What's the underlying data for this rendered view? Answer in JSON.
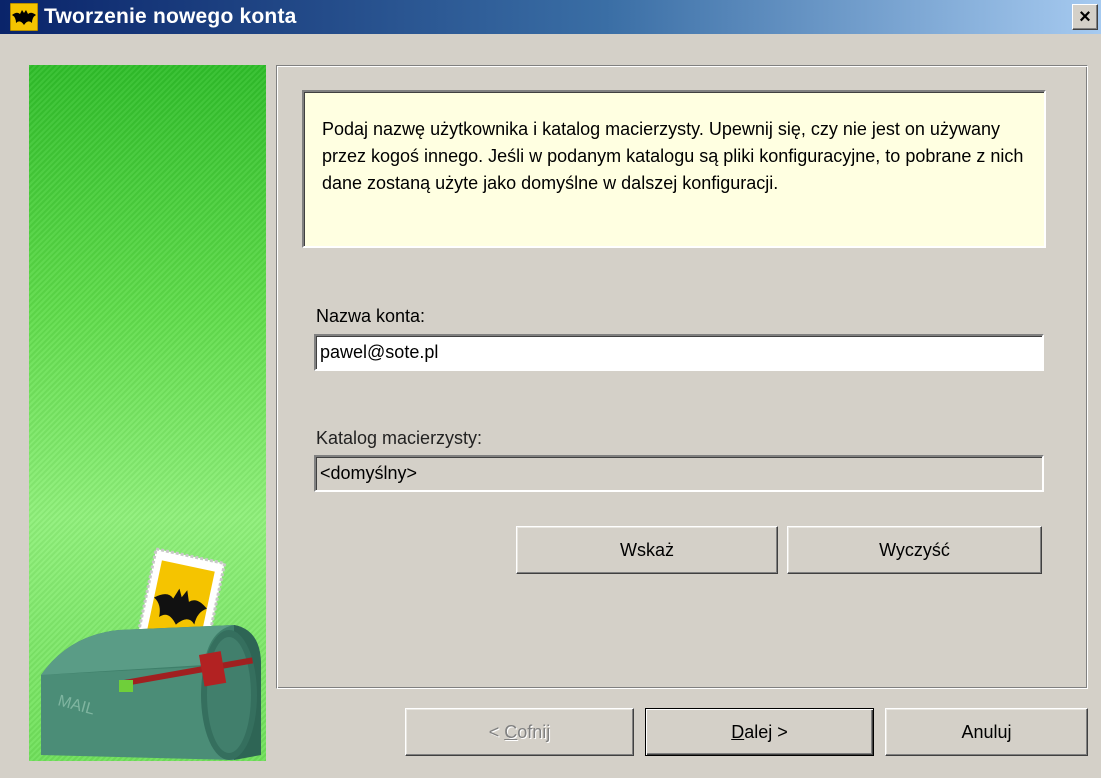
{
  "window": {
    "title": "Tworzenie nowego konta",
    "close_glyph": "×"
  },
  "banner": {
    "mailbox_label": "MAIL",
    "icon": "mailbox-bat-stamp-illustration"
  },
  "info": {
    "text": "Podaj nazwę użytkownika i katalog macierzysty. Upewnij się, czy nie jest on używany przez kogoś innego. Jeśli w podanym katalogu są pliki konfiguracyjne, to pobrane z nich dane zostaną użyte jako domyślne w dalszej konfiguracji."
  },
  "account": {
    "label": "Nazwa konta:",
    "value": "pawel@sote.pl"
  },
  "home_dir": {
    "label": "Katalog macierzysty:",
    "value": "<domyślny>"
  },
  "buttons": {
    "browse": "Wskaż",
    "clear": "Wyczyść",
    "back_prefix": "< ",
    "back_accel": "C",
    "back_rest": "ofnij",
    "next_accel": "D",
    "next_rest": "alej >",
    "cancel": "Anuluj"
  },
  "colors": {
    "title_gradient_start": "#0a246a",
    "dialog_face": "#d4d0c8",
    "info_background": "#ffffe1",
    "banner_green": "#5fdc4a"
  }
}
